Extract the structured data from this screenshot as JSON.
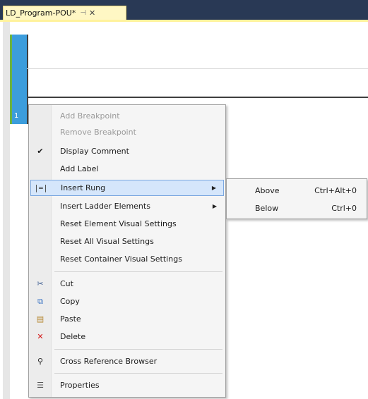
{
  "tab": {
    "title": "LD_Program-POU*",
    "pin_icon": "⊣",
    "close_icon": "✕"
  },
  "rung": {
    "number": "1"
  },
  "context_menu": {
    "items": [
      {
        "label": "Add Breakpoint",
        "disabled": true
      },
      {
        "label": "Remove Breakpoint",
        "disabled": true
      },
      {
        "label": "Display Comment",
        "icon": "✔"
      },
      {
        "label": "Add Label"
      },
      {
        "label": "Insert Rung",
        "icon": "|=|",
        "submenu_arrow": "▶"
      },
      {
        "label": "Insert Ladder Elements",
        "submenu_arrow": "▶"
      },
      {
        "label": "Reset Element Visual Settings"
      },
      {
        "label": "Reset All Visual Settings"
      },
      {
        "label": "Reset Container Visual Settings"
      },
      {
        "label": "Cut",
        "icon": "✂"
      },
      {
        "label": "Copy",
        "icon": "⧉"
      },
      {
        "label": "Paste",
        "icon": "▤"
      },
      {
        "label": "Delete",
        "icon": "✕"
      },
      {
        "label": "Cross Reference Browser",
        "icon": "⚲"
      },
      {
        "label": "Properties",
        "icon": "☰"
      }
    ]
  },
  "submenu": {
    "items": [
      {
        "label": "Above",
        "shortcut": "Ctrl+Alt+0"
      },
      {
        "label": "Below",
        "shortcut": "Ctrl+0"
      }
    ]
  },
  "colors": {
    "titlebar": "#293955",
    "tab": "#fff7c4",
    "rung_bar": "#3c9ddc",
    "highlight": "#d5e6fb",
    "delete": "#d41a1a"
  }
}
